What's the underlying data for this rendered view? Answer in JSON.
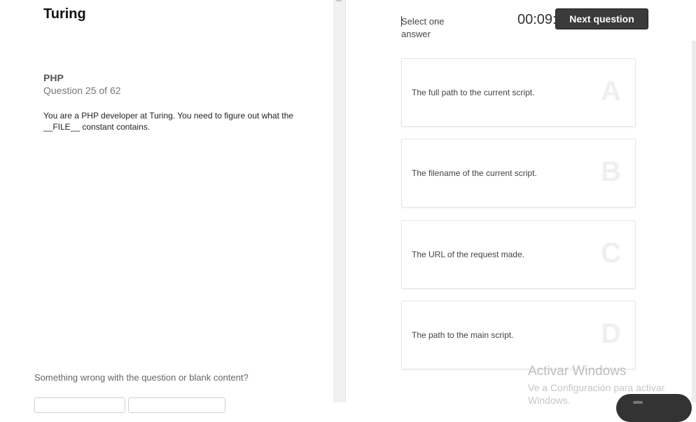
{
  "app": {
    "brand": "Turing"
  },
  "question": {
    "topic": "PHP",
    "counter": "Question 25 of 62",
    "text": "You are a PHP developer at Turing. You need to figure out what the __FILE__ constant contains."
  },
  "report": {
    "prompt": "Something wrong with the question or blank content?"
  },
  "answer_panel": {
    "instruction": "Select one answer",
    "timer": "00:09:",
    "next_label": "Next question",
    "options": [
      {
        "letter": "A",
        "text": "The full path to the current script."
      },
      {
        "letter": "B",
        "text": "The filename of the current script."
      },
      {
        "letter": "C",
        "text": "The URL of the request made."
      },
      {
        "letter": "D",
        "text": "The path to the main script."
      }
    ]
  },
  "watermark": {
    "title": "Activar Windows",
    "subtitle": "Ve a Configuración para activar Windows."
  },
  "colors": {
    "button_bg": "#3b3b3b",
    "panel_divider": "#f1f1f1",
    "option_border": "#e6e6e6"
  }
}
